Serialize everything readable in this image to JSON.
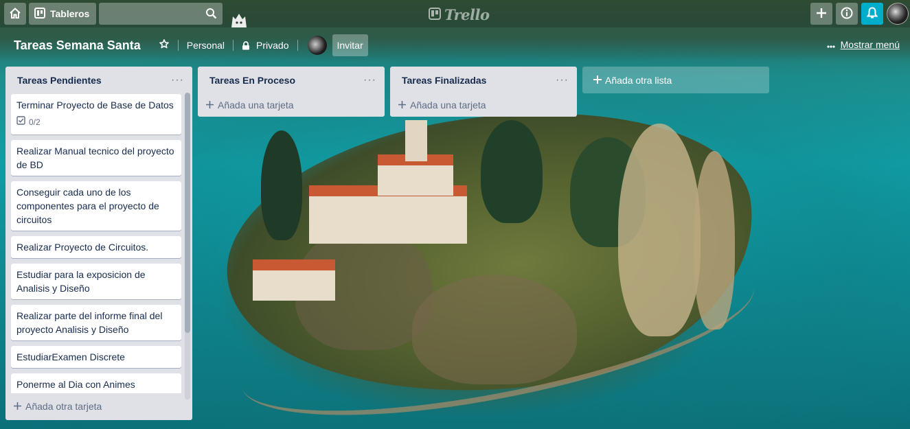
{
  "header": {
    "boards_label": "Tableros",
    "search_value": "",
    "logo_text": "Trello",
    "bell_color": "#00aecc"
  },
  "board": {
    "title": "Tareas Semana Santa",
    "team": "Personal",
    "visibility": "Privado",
    "invite_label": "Invitar",
    "menu_label": "Mostrar menú"
  },
  "lists": [
    {
      "name": "Tareas Pendientes",
      "cards": [
        {
          "title": "Terminar Proyecto de Base de Datos",
          "checklist": "0/2"
        },
        {
          "title": "Realizar Manual tecnico del proyecto de BD"
        },
        {
          "title": "Conseguir cada uno de los componentes para el proyecto de circuitos"
        },
        {
          "title": "Realizar Proyecto de Circuitos."
        },
        {
          "title": "Estudiar para la exposicion de Analisis y Diseño"
        },
        {
          "title": "Realizar parte del informe final del proyecto Analisis y Diseño"
        },
        {
          "title": "EstudiarExamen Discrete"
        },
        {
          "title": "Ponerme al Dia con Animes"
        }
      ],
      "add_label": "Añada otra tarjeta"
    },
    {
      "name": "Tareas En Proceso",
      "cards": [],
      "add_label": "Añada una tarjeta"
    },
    {
      "name": "Tareas Finalizadas",
      "cards": [],
      "add_label": "Añada una tarjeta"
    }
  ],
  "add_list_label": "Añada otra lista",
  "icons": [
    "home-icon",
    "boards-icon",
    "search-icon",
    "plus-icon",
    "info-icon",
    "bell-icon",
    "star-icon",
    "lock-icon",
    "ellipsis-icon",
    "checklist-icon"
  ]
}
